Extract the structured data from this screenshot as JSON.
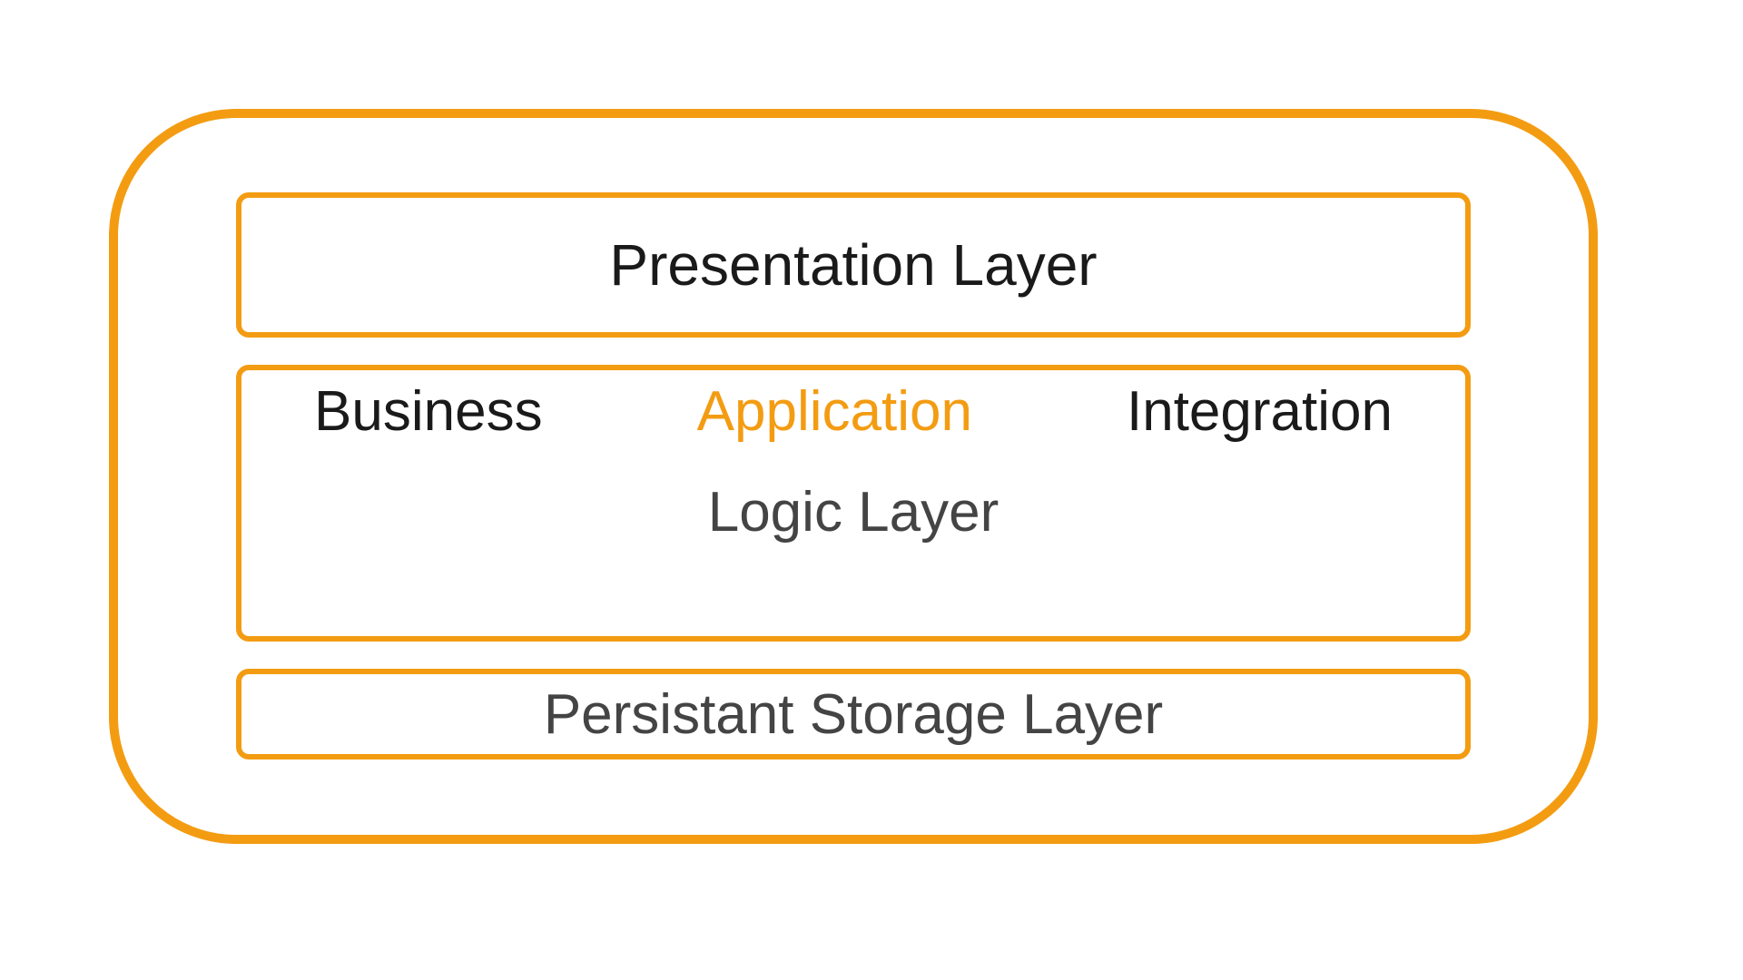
{
  "diagram": {
    "presentation": {
      "label": "Presentation Layer"
    },
    "logic": {
      "business": "Business",
      "application": "Application",
      "integration": "Integration",
      "subtitle": "Logic Layer"
    },
    "storage": {
      "label": "Persistant Storage Layer"
    }
  },
  "colors": {
    "accent": "#f39c12",
    "text_dark": "#1a1a1a",
    "text_muted": "#444444"
  }
}
